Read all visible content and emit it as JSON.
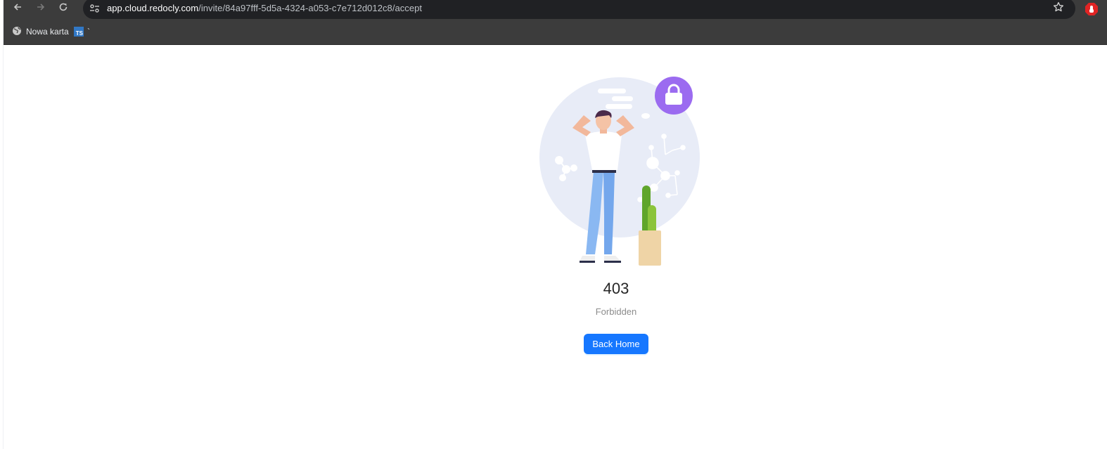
{
  "browser": {
    "url_host": "app.cloud.redocly.com",
    "url_path": "/invite/84a97fff-5d5a-4324-a053-c7e712d012c8/accept",
    "nav": {
      "back_icon": "arrow-left-icon",
      "forward_icon": "arrow-right-icon",
      "reload_icon": "reload-icon",
      "site_info_icon": "tune-icon",
      "bookmark_icon": "star-icon"
    },
    "bookmarks": [
      {
        "label": "Nowa karta",
        "icon": "globe-icon"
      },
      {
        "label": "`",
        "icon": "ts-icon",
        "icon_text": "TS"
      }
    ]
  },
  "page": {
    "status_code": "403",
    "status_text": "Forbidden",
    "back_home_label": "Back Home",
    "illustration": "forbidden-illustration",
    "lock_icon": "lock-icon"
  },
  "colors": {
    "primary": "#1677ff",
    "lock_badge": "#9b6bf0",
    "bubble": "#e8ecf7"
  }
}
